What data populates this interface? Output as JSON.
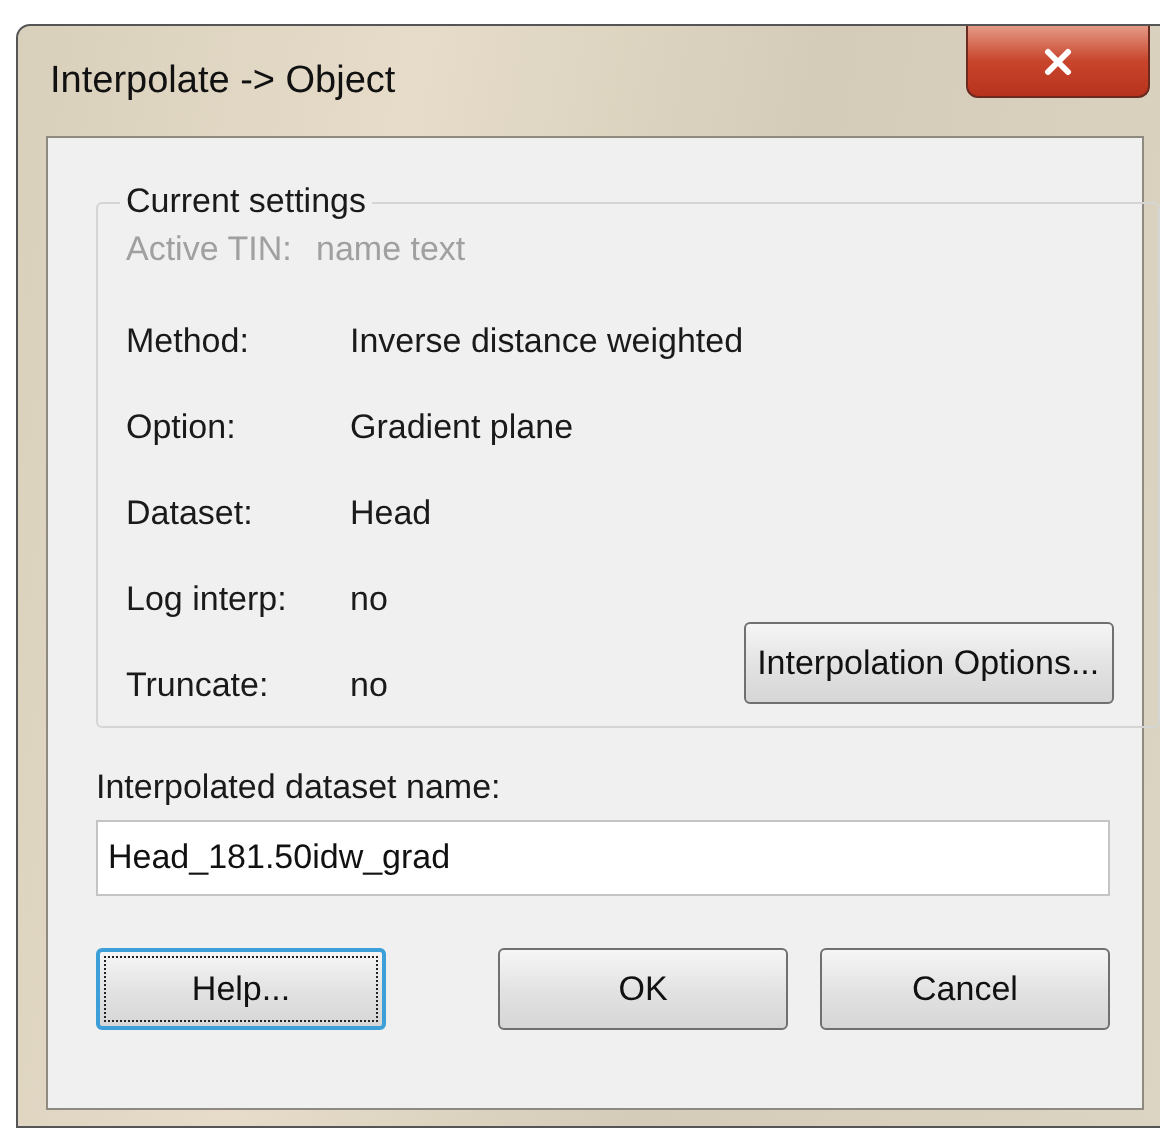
{
  "window": {
    "title": "Interpolate -> Object"
  },
  "settings": {
    "title": "Current settings",
    "rows": [
      {
        "label": "Active TIN:",
        "value": "name text",
        "disabled": true
      },
      {
        "label": "Method:",
        "value": "Inverse distance weighted",
        "disabled": false
      },
      {
        "label": "Option:",
        "value": "Gradient plane",
        "disabled": false
      },
      {
        "label": "Dataset:",
        "value": "Head",
        "disabled": false
      },
      {
        "label": "Log interp:",
        "value": "no",
        "disabled": false
      },
      {
        "label": "Truncate:",
        "value": "no",
        "disabled": false
      }
    ],
    "options_button": "Interpolation Options..."
  },
  "dataset_name": {
    "label": "Interpolated dataset name:",
    "value": "Head_181.50idw_grad"
  },
  "buttons": [
    {
      "label": "Help...",
      "focused": true
    },
    {
      "label": "OK",
      "focused": false
    },
    {
      "label": "Cancel",
      "focused": false
    }
  ]
}
